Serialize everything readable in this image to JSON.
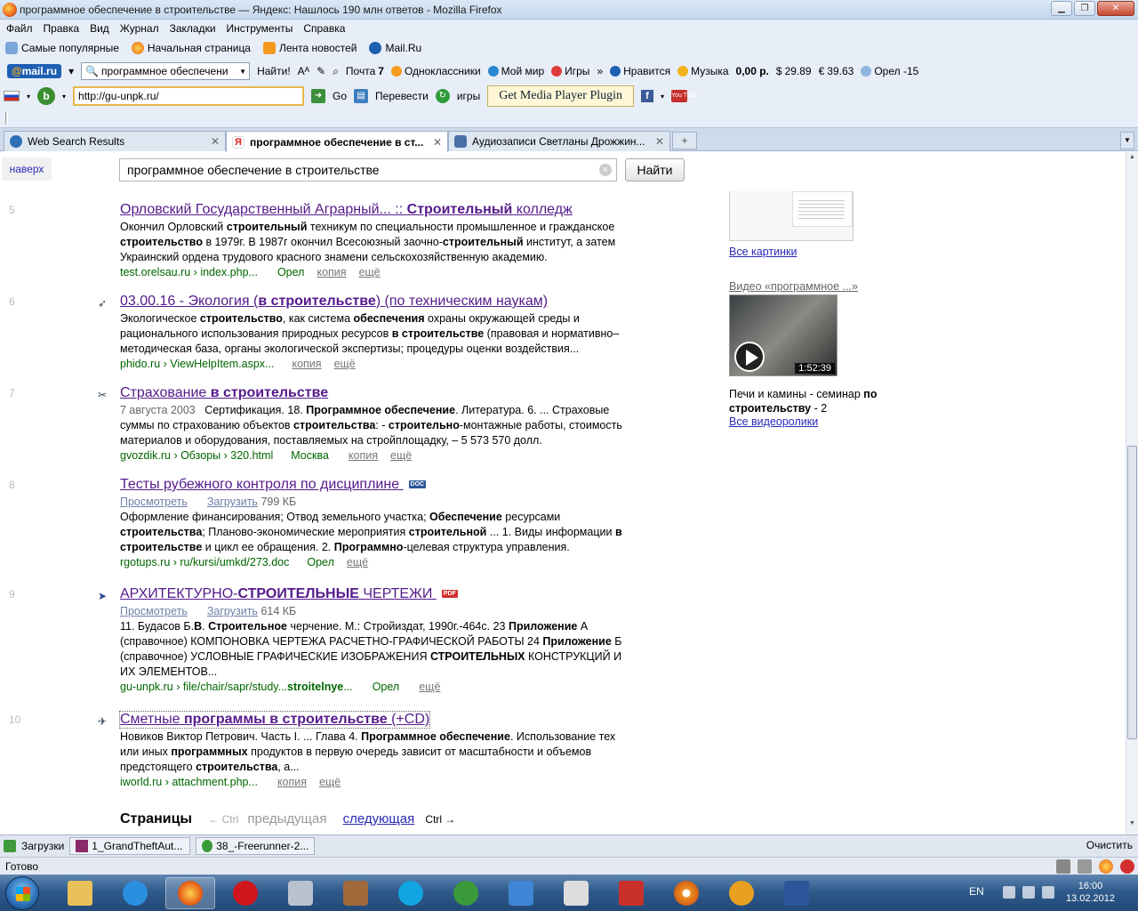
{
  "window": {
    "title": "программное обеспечение в строительстве — Яндекс: Нашлось 190 млн ответов - Mozilla Firefox"
  },
  "menu": [
    "Файл",
    "Правка",
    "Вид",
    "Журнал",
    "Закладки",
    "Инструменты",
    "Справка"
  ],
  "bookmarks": [
    "Самые популярные",
    "Начальная страница",
    "Лента новостей",
    "Mail.Ru"
  ],
  "mailbar": {
    "logo_at": "@",
    "logo_text": "mail.ru",
    "search_value": "программное обеспечени",
    "find_btn": "Найти!",
    "mail_label": "Почта",
    "mail_count": "7",
    "items": [
      "Одноклассники",
      "Мой мир",
      "Игры",
      "Нравится",
      "Музыка"
    ],
    "money": "0,00 р.",
    "usd": "29.89",
    "eur": "39.63",
    "weather": "Орел -15"
  },
  "bingbar": {
    "url": "http://gu-unpk.ru/",
    "go": "Go",
    "translate": "Перевести",
    "games": "игры",
    "media_plugin": "Get Media Player Plugin",
    "yt_label": "You Tube"
  },
  "tabs": [
    {
      "label": "Web Search Results",
      "active": false
    },
    {
      "label": "программное обеспечение в ст...",
      "active": true
    },
    {
      "label": "Аудиозаписи Светланы Дрожжин...",
      "active": false
    }
  ],
  "page": {
    "top_link": "наверх",
    "search_value": "программное обеспечение в строительстве",
    "search_btn": "Найти",
    "results": [
      {
        "num": "5",
        "title_a": "Орловский Государственный Аграрный... :: ",
        "title_b": "Строительный",
        "title_c": " колледж",
        "l1a": "Окончил Орловский ",
        "l1b": "строительный",
        "l1c": " техникум по специальности промышленное и гражданское",
        "l2a": "строительство",
        "l2b": " в 1979г. В 1987г окончил Всесоюзный заочно-",
        "l2c": "строительный",
        "l2d": " институт, а затем",
        "l3": "Украинский ордена трудового красного знамени сельскохозяйственную академию.",
        "url": "test.orelsau.ru › index.php...",
        "region": "Орел",
        "copy": "копия",
        "more": "ещё"
      },
      {
        "num": "6",
        "title_a": "03.00.16 - Экология (",
        "title_b": "в строительстве",
        "title_c": ") (по техническим наукам)",
        "l1a": "Экологическое ",
        "l1b": "строительство",
        "l1c": ", как система ",
        "l1d": "обеспечения",
        "l1e": " охраны окружающей среды и",
        "l2a": "рационального использования природных ресурсов ",
        "l2b": "в строительстве",
        "l2c": " (правовая и нормативно–",
        "l3": "методическая база, органы экологической экспертизы; процедуры оценки воздействия...",
        "url": "phido.ru › ViewHelpItem.aspx...",
        "copy": "копия",
        "more": "ещё"
      },
      {
        "num": "7",
        "title_a": "Страхование ",
        "title_b": "в строительстве",
        "date": "7 августа 2003",
        "l1a": "Сертификация. 18. ",
        "l1b": "Программное обеспечение",
        "l1c": ". Литература. 6. ... Страховые",
        "l2a": "суммы по страхованию объектов ",
        "l2b": "строительства",
        "l2c": ": - ",
        "l2d": "строительно",
        "l2e": "-монтажные работы, стоимость",
        "l3": "материалов и оборудования, поставляемых на стройплощадку, – 5 573 570 долл.",
        "url": "gvozdik.ru › Обзоры › 320.html",
        "region": "Москва",
        "copy": "копия",
        "more": "ещё"
      },
      {
        "num": "8",
        "title_a": "Тесты рубежного контроля по дисциплине ",
        "file": "DOC",
        "view": "Просмотреть",
        "download": "Загрузить",
        "size": "799 КБ",
        "l1a": "Оформление финансирования; Отвод земельного участка; ",
        "l1b": "Обеспечение",
        "l1c": " ресурсами",
        "l2a": "строительства",
        "l2b": "; Планово-экономические мероприятия ",
        "l2c": "строительной",
        "l2d": " ... 1. Виды информации ",
        "l2e": "в",
        "l3a": "строительстве",
        "l3b": " и цикл ее обращения. 2. ",
        "l3c": "Программно",
        "l3d": "-целевая структура управления.",
        "url": "rgotups.ru › ru/kursi/umkd/273.doc",
        "region": "Орел",
        "more": "ещё"
      },
      {
        "num": "9",
        "title_a": "АРХИТЕКТУРНО-",
        "title_b": "СТРОИТЕЛЬНЫЕ",
        "title_c": " ЧЕРТЕЖИ ",
        "file": "PDF",
        "view": "Просмотреть",
        "download": "Загрузить",
        "size": "614 КБ",
        "l1a": "11. Будасов Б.",
        "l1b": "В",
        "l1c": ". ",
        "l1d": "Строительное",
        "l1e": " черчение. М.: Стройиздат, 1990г.-464с. 23 ",
        "l1f": "Приложение",
        "l1g": " А",
        "l2a": "(справочное) КОМПОНОВКА ЧЕРТЕЖА РАСЧЕТНО-ГРАФИЧЕСКОЙ РАБОТЫ 24 ",
        "l2b": "Приложение",
        "l2c": " Б",
        "l3a": "(справочное) УСЛОВНЫЕ ГРАФИЧЕСКИЕ ИЗОБРАЖЕНИЯ ",
        "l3b": "СТРОИТЕЛЬНЫХ",
        "l3c": " КОНСТРУКЦИЙ И",
        "l4": "ИХ ЭЛЕМЕНТОВ...",
        "url_a": "gu-unpk.ru › file/chair/sapr/study...",
        "url_b": "stroitelnye",
        "url_c": "...",
        "region": "Орел",
        "more": "ещё"
      },
      {
        "num": "10",
        "title_a": "Сметные ",
        "title_b": "программы в строительстве",
        "title_c": " (+CD)",
        "l1a": "Новиков Виктор Петрович. Часть I. ... Глава 4. ",
        "l1b": "Программное обеспечение",
        "l1c": ". Использование тех",
        "l2a": "или иных ",
        "l2b": "программных",
        "l2c": " продуктов в первую очередь зависит от масштабности и объемов",
        "l3a": "предстоящего ",
        "l3b": "строительства",
        "l3c": ", а...",
        "url": "iworld.ru › attachment.php...",
        "copy": "копия",
        "more": "ещё"
      }
    ],
    "pager": {
      "label": "Страницы",
      "prev_key": "← Ctrl",
      "prev": "предыдущая",
      "next": "следующая",
      "next_key": "Ctrl →"
    },
    "sidebar": {
      "all_images": "Все картинки",
      "video_header": "Видео «программное ...»",
      "video_duration": "1:52:39",
      "video_title_a": "Печи и камины - семинар ",
      "video_title_b": "по",
      "video_title_c": "строительству",
      "video_title_d": " - 2",
      "all_videos": "Все видеоролики"
    }
  },
  "downloads": {
    "label": "Загрузки",
    "items": [
      "1_GrandTheftAut...",
      "38_-Freerunner-2..."
    ],
    "clear": "Очистить"
  },
  "status": {
    "text": "Готово"
  },
  "taskbar": {
    "lang": "EN",
    "time": "16:00",
    "date": "13.02.2012"
  },
  "colors": {
    "link": "#551a8b",
    "url_green": "#006600",
    "title_bar": "#c6d7ec"
  }
}
